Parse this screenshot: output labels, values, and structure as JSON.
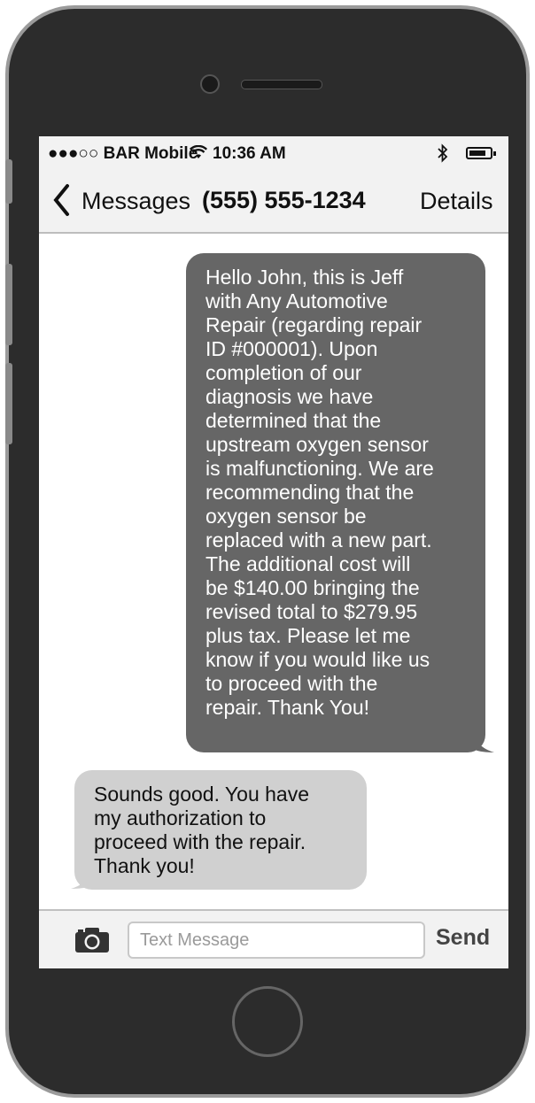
{
  "status_bar": {
    "carrier": "●●●○○ BAR Mobile",
    "wifi_icon": "wifi-icon",
    "time": "10:36 AM",
    "bluetooth_icon": "bluetooth-icon",
    "battery_icon": "battery-icon"
  },
  "nav": {
    "back_label": "Messages",
    "title": "(555) 555-1234",
    "details_label": "Details"
  },
  "messages": [
    {
      "direction": "outgoing",
      "lines": [
        "Hello John, this is Jeff",
        "with Any Automotive",
        "Repair (regarding repair",
        "ID #000001). Upon",
        "completion of our",
        "diagnosis we have",
        "determined that the",
        "upstream oxygen sensor",
        "is malfunctioning. We are",
        "recommending that the",
        "oxygen sensor be",
        "replaced with a new part.",
        "The additional cost will",
        "be $140.00 bringing the",
        "revised total to $279.95",
        "plus tax. Please let me",
        "know if you would like us",
        "to proceed with the",
        "repair. Thank You!"
      ]
    },
    {
      "direction": "incoming",
      "lines": [
        "Sounds good. You have",
        "my authorization to",
        "proceed with the repair.",
        "Thank you!"
      ]
    }
  ],
  "composer": {
    "placeholder": "Text Message",
    "send_label": "Send",
    "camera_icon": "camera-icon"
  },
  "colors": {
    "outgoing_bubble": "#666666",
    "incoming_bubble": "#d0d0d0",
    "bar_background": "#f2f2f2"
  }
}
